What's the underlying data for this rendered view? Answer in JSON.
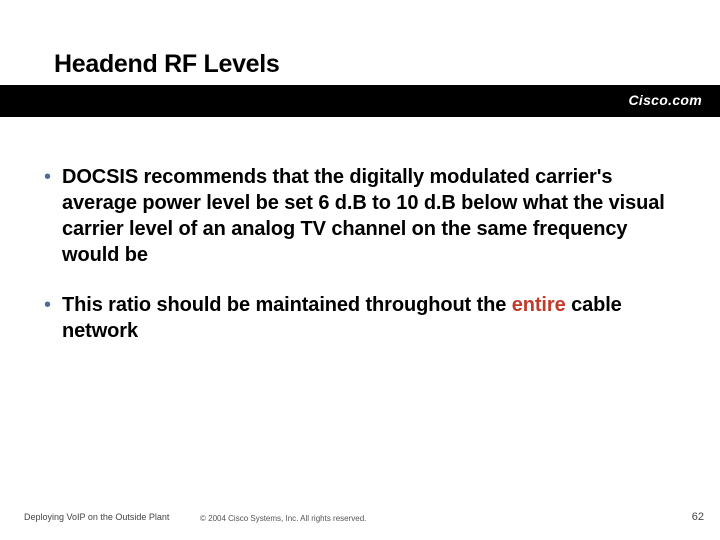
{
  "title": "Headend RF Levels",
  "brand": "Cisco.com",
  "bullets": [
    {
      "text_a": "DOCSIS recommends that the digitally modulated carrier's average power level be set 6 d.B to 10 d.B below what the visual carrier level of an analog TV channel on the same frequency would be"
    },
    {
      "text_a": "This ratio should be maintained throughout the ",
      "highlight": "entire",
      "text_b": " cable network"
    }
  ],
  "footer": {
    "left": "Deploying VoIP on the Outside Plant",
    "center": "© 2004 Cisco Systems, Inc. All rights reserved.",
    "pagenum": "62"
  }
}
